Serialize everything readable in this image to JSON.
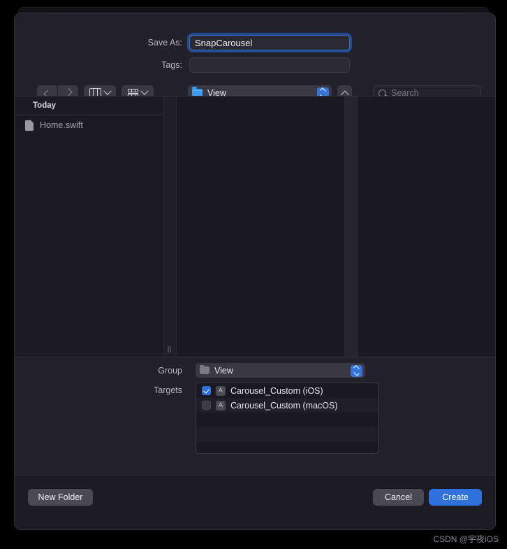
{
  "background_window": {
    "title_hint": ""
  },
  "form": {
    "save_as_label": "Save As:",
    "save_as_value": "SnapCarousel",
    "tags_label": "Tags:",
    "tags_value": "",
    "tags_placeholder": ""
  },
  "toolbar": {
    "back_icon": "chevron-left-icon",
    "forward_icon": "chevron-right-icon",
    "view_icon": "column-view-icon",
    "group_icon": "group-by-icon",
    "path_label": "View",
    "path_folder_icon": "folder-icon",
    "stepper_icon": "stepper-updown-icon",
    "up_icon": "chevron-up-icon",
    "search_placeholder": "Search",
    "search_value": "",
    "search_icon": "search-icon"
  },
  "sidebar": {
    "section_title": "Today",
    "items": [
      {
        "label": "Home.swift",
        "icon": "document-icon"
      }
    ]
  },
  "options": {
    "group_label": "Group",
    "group_value": "View",
    "targets_label": "Targets",
    "targets": [
      {
        "name": "Carousel_Custom (iOS)",
        "checked": true,
        "icon": "app-target-icon"
      },
      {
        "name": "Carousel_Custom (macOS)",
        "checked": false,
        "icon": "app-target-icon"
      }
    ]
  },
  "footer": {
    "new_folder_label": "New Folder",
    "cancel_label": "Cancel",
    "create_label": "Create"
  },
  "watermark": {
    "text": "CSDN @宇夜iOS"
  },
  "colors": {
    "accent_blue": "#2f72dd",
    "focus_ring": "#2f6fd0",
    "folder_blue": "#3a9bf0",
    "sheet_bg": "#1d1b24",
    "form_bg": "#22202a"
  }
}
